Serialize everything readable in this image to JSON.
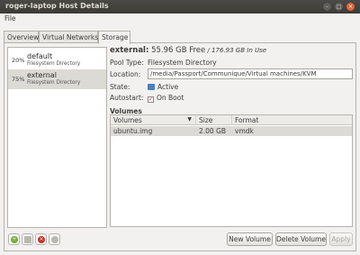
{
  "window": {
    "title": "roger-laptop Host Details",
    "controls": {
      "minimize": "–",
      "maximize": "□",
      "close": "×"
    }
  },
  "menubar": {
    "items": [
      "File"
    ]
  },
  "tabs": [
    "Overview",
    "Virtual Networks",
    "Storage"
  ],
  "active_tab": "Storage",
  "pools": [
    {
      "percent": "20%",
      "name": "default",
      "type": "Filesystem Directory"
    },
    {
      "percent": "75%",
      "name": "external",
      "type": "Filesystem Directory",
      "selected": true
    }
  ],
  "pool_details": {
    "name": "external:",
    "free": "55.96 GB Free",
    "sep": " / ",
    "in_use": "176.93 GB In Use",
    "pool_type_label": "Pool Type:",
    "pool_type": "Filesystem Directory",
    "location_label": "Location:",
    "location": "/media/Passport/Communique/Virtual machines/KVM",
    "state_label": "State:",
    "state": "Active",
    "autostart_label": "Autostart:",
    "autostart": "On Boot",
    "autostart_check": "✓"
  },
  "volumes": {
    "heading": "Volumes",
    "columns": [
      "Volumes",
      "Size",
      "Format"
    ],
    "sort_arrow": "▼",
    "rows": [
      {
        "name": "ubuntu.img",
        "size": "2.00 GB",
        "format": "vmdk"
      }
    ]
  },
  "buttons": {
    "new_volume": "New Volume",
    "delete_volume": "Delete Volume",
    "apply": "Apply",
    "add_pool_glyph": "+",
    "stop_pool_glyph": "×"
  },
  "colors": {
    "titlebar": "#3c3b37",
    "close_button": "#e4663b",
    "add": "#6fae3d",
    "delete": "#c9302c"
  }
}
